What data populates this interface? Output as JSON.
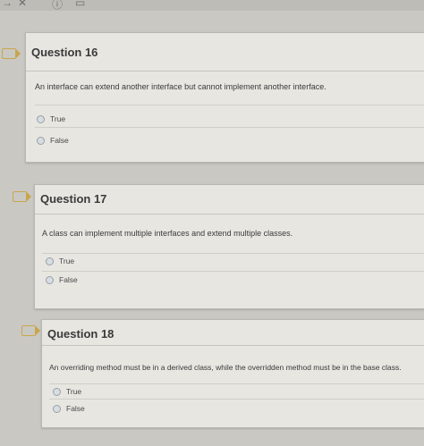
{
  "questions": [
    {
      "title": "Question 16",
      "text": "An interface can extend another interface but cannot implement another interface.",
      "options": [
        "True",
        "False"
      ]
    },
    {
      "title": "Question 17",
      "text": "A class can implement multiple interfaces and extend multiple classes.",
      "options": [
        "True",
        "False"
      ]
    },
    {
      "title": "Question 18",
      "text": "An overriding method must be in a derived class, while the overridden method must be in the base class.",
      "options": [
        "True",
        "False"
      ]
    }
  ],
  "icons": [
    "back-arrow-icon",
    "close-icon",
    "info-icon",
    "save-icon",
    "flag-icon"
  ]
}
